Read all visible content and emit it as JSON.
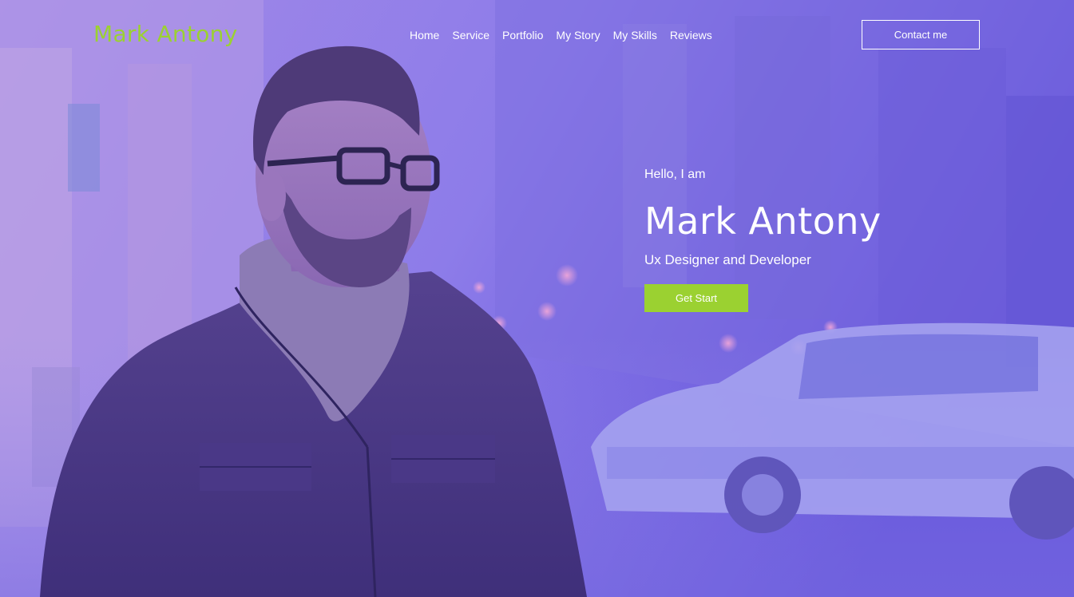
{
  "brand": {
    "logo_text": "Mark Antony",
    "accent_color": "#9bd131",
    "overlay_color": "#6b5ce0"
  },
  "nav": {
    "items": [
      "Home",
      "Service",
      "Portfolio",
      "My Story",
      "My Skills",
      "Reviews"
    ]
  },
  "header": {
    "contact_label": "Contact me"
  },
  "hero": {
    "greeting": "Hello, I am",
    "name": "Mark Antony",
    "role": "Ux Designer and Developer",
    "cta_label": "Get Start",
    "photo_subject": "man-with-glasses-portrait"
  }
}
